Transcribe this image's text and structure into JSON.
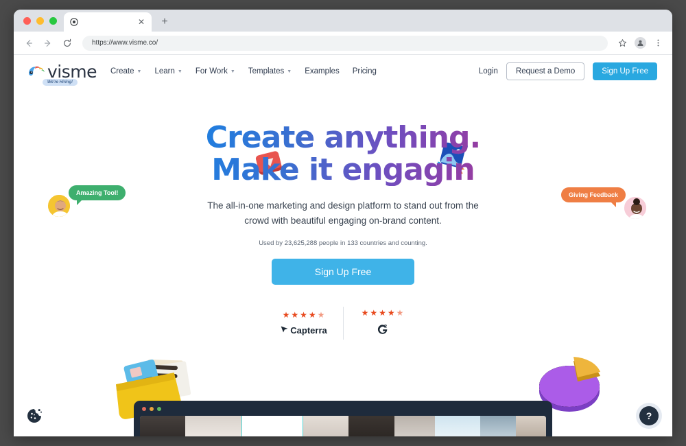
{
  "browser": {
    "tab": {
      "title": "",
      "favicon_icon": "target-favicon",
      "close_icon": "close-icon"
    },
    "new_tab_label": "+",
    "nav": {
      "back_icon": "arrow-left-icon",
      "forward_icon": "arrow-right-icon",
      "reload_icon": "reload-icon"
    },
    "url": "https://www.visme.co/",
    "toolbar_icons": {
      "bookmark": "star-icon",
      "profile": "profile-avatar-icon",
      "menu": "three-dot-menu-icon"
    }
  },
  "site_header": {
    "brand": {
      "word": "visme",
      "logo_icon": "visme-chameleon-logo",
      "hiring_badge": "We're Hiring!"
    },
    "nav_items": [
      {
        "label": "Create",
        "has_dropdown": true
      },
      {
        "label": "Learn",
        "has_dropdown": true
      },
      {
        "label": "For Work",
        "has_dropdown": true
      },
      {
        "label": "Templates",
        "has_dropdown": true
      },
      {
        "label": "Examples",
        "has_dropdown": false
      },
      {
        "label": "Pricing",
        "has_dropdown": false
      }
    ],
    "login_label": "Login",
    "demo_label": "Request a Demo",
    "signup_label": "Sign Up Free"
  },
  "hero": {
    "headline_line1": "Create anything.",
    "headline_line2": "Make it engagin",
    "subhead_line1": "The all-in-one marketing and design platform to stand out from the crowd",
    "subhead_line2": "with beautiful engaging on-brand content.",
    "usedby": "Used by 23,625,288 people in 133 countries and counting.",
    "cta_label": "Sign Up Free",
    "colors": {
      "gradient_start": "#1a3ca8",
      "gradient_mid": "#1f7fe0",
      "gradient_end": "#d42d66",
      "cta_blue": "#3fb3e8",
      "header_blue": "#29a8e0"
    }
  },
  "ratings": [
    {
      "brand": "Capterra",
      "brand_icon": "capterra-cursor-icon",
      "stars_full": 4,
      "stars_half": 1,
      "rating": 4.5
    },
    {
      "brand": "G2",
      "brand_icon": "g2-logo-icon",
      "stars_full": 4,
      "stars_half": 1,
      "rating": 4.5
    }
  ],
  "testimonials": [
    {
      "text": "Amazing Tool!",
      "color": "#3eaf6e",
      "avatar_name": "male-avatar",
      "avatar_bg": "#f5c531",
      "position": "left"
    },
    {
      "text": "Giving Feedback",
      "color": "#ef7e44",
      "avatar_name": "female-avatar",
      "avatar_bg": "#f7cdd8",
      "position": "right"
    }
  ],
  "decorations": [
    {
      "name": "video-play-icon-3d",
      "color": "#e0504f"
    },
    {
      "name": "image-asset-icon-3d",
      "color": "#1b5fc4"
    },
    {
      "name": "folder-documents-icon-3d",
      "color": "#e8b923"
    },
    {
      "name": "pie-chart-icon-3d",
      "color": "#9b51e0"
    }
  ],
  "app_mockup": {
    "dots": [
      "#e06b5a",
      "#e8a33d",
      "#5fb85f"
    ],
    "bg": "#1e2b3c"
  },
  "widgets": {
    "cookie_icon": "cookie-consent-icon",
    "help_label": "?"
  }
}
